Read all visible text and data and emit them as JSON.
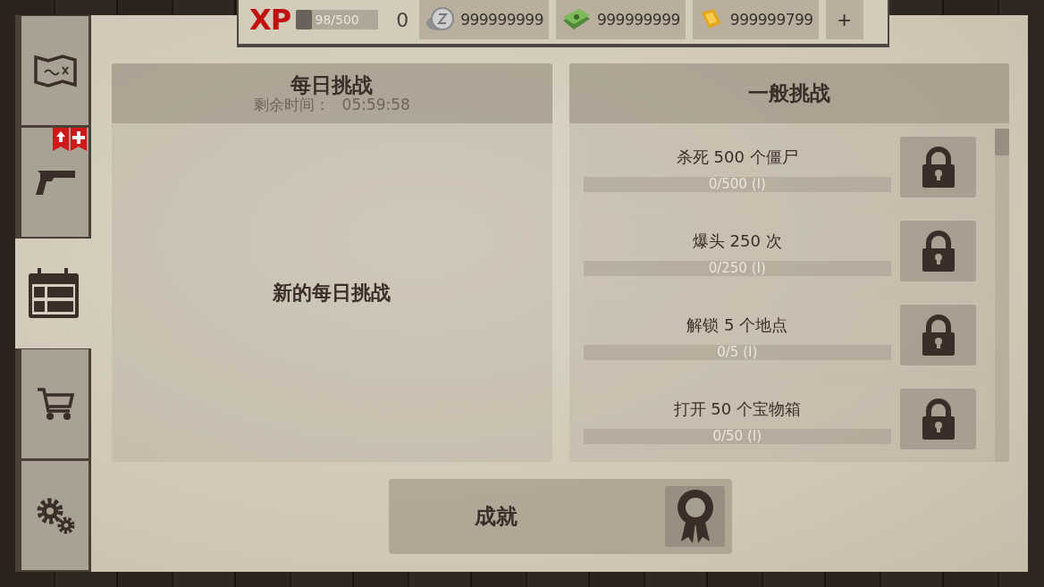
{
  "top_bar": {
    "xp_label": "XP",
    "xp_bar": {
      "level": 0.196,
      "reading": "98/500"
    },
    "player_level": "0",
    "currencies": [
      {
        "kind": "silver",
        "amount": "999999999"
      },
      {
        "kind": "cash",
        "amount": "999999999"
      },
      {
        "kind": "gold",
        "amount": "999999799"
      }
    ],
    "add_button": "+"
  },
  "sidebar": {
    "tabs": [
      {
        "kind": "map",
        "selected": false
      },
      {
        "kind": "pistol",
        "selected": false,
        "badges": [
          {
            "kind": "upgrade"
          },
          {
            "kind": "plus"
          }
        ]
      },
      {
        "kind": "calendar",
        "selected": true
      },
      {
        "kind": "cart",
        "selected": false
      },
      {
        "kind": "gears",
        "selected": false
      }
    ]
  },
  "daily_challenges": {
    "title": "每日挑战",
    "timer_label": "剩余时间：",
    "timer": "05:59:58",
    "message": "新的每日挑战"
  },
  "general_challenges": {
    "title": "一般挑战",
    "items": [
      {
        "title": "杀死 500 个僵尸",
        "progress": "0/500 (I)",
        "level": 0,
        "locked": true
      },
      {
        "title": "爆头 250 次",
        "progress": "0/250 (I)",
        "level": 0,
        "locked": true
      },
      {
        "title": "解锁 5 个地点",
        "progress": "0/5 (I)",
        "level": 0,
        "locked": true
      },
      {
        "title": "打开 50 个宝物箱",
        "progress": "0/50 (I)",
        "level": 0,
        "locked": true
      }
    ]
  },
  "achievements_button": {
    "label": "成就"
  }
}
